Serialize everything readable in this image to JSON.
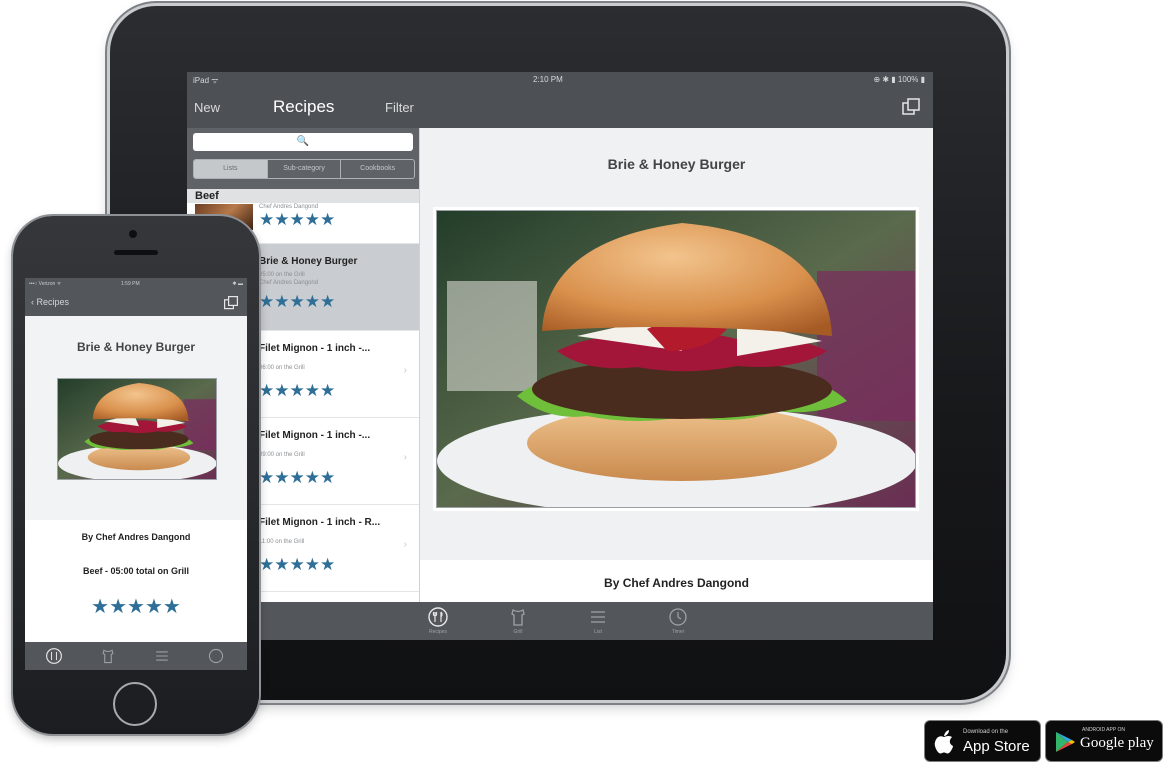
{
  "ipad": {
    "status": {
      "left": "iPad ᯤ",
      "time": "2:10 PM",
      "right": "⊕ ✱ ▮ 100% ▮"
    },
    "nav": {
      "new_label": "New",
      "title": "Recipes",
      "filter_label": "Filter"
    },
    "search": {
      "placeholder": "🔍"
    },
    "segments": [
      "Lists",
      "Sub-category",
      "Cookbooks"
    ],
    "section_header": "Beef",
    "list": [
      {
        "title": "",
        "sub1": "Chef Andres Dangond",
        "sub2": "",
        "stars": "★★★★★",
        "selected": false
      },
      {
        "title": "Brie & Honey Burger",
        "sub1": "05:00 on the Grill",
        "sub2": "Chef Andres Dangond",
        "stars": "★★★★★",
        "selected": true
      },
      {
        "title": "Filet Mignon - 1 inch -...",
        "sub1": "06:00 on the Grill",
        "sub2": "",
        "stars": "★★★★★",
        "selected": false
      },
      {
        "title": "Filet Mignon - 1 inch -...",
        "sub1": "09:00 on the Grill",
        "sub2": "",
        "stars": "★★★★★",
        "selected": false
      },
      {
        "title": "Filet Mignon - 1 inch - R...",
        "sub1": "11:00 on the Grill",
        "sub2": "",
        "stars": "★★★★★",
        "selected": false
      }
    ],
    "detail": {
      "title": "Brie & Honey Burger",
      "byline": "By Chef Andres Dangond"
    },
    "tabbar": [
      {
        "icon": "recipes-icon",
        "label": "Recipes"
      },
      {
        "icon": "apron-icon",
        "label": "Grill"
      },
      {
        "icon": "list-icon",
        "label": "List"
      },
      {
        "icon": "timer-icon",
        "label": "Timer"
      }
    ]
  },
  "iphone": {
    "status": {
      "left": "•••○ Verizon ᯤ",
      "time": "1:59 PM",
      "right": "✱ ▬"
    },
    "nav": {
      "back_label": "Recipes"
    },
    "detail": {
      "title": "Brie & Honey Burger",
      "byline": "By Chef Andres Dangond",
      "meta": "Beef - 05:00 total on Grill",
      "stars": "★★★★★"
    }
  },
  "badges": {
    "apple": {
      "small": "Download on the",
      "big": "App Store"
    },
    "google": {
      "small": "ANDROID APP ON",
      "big": "Google play"
    }
  },
  "colors": {
    "star": "#2f6f97",
    "chrome": "#4d5155",
    "selected_row": "#c9ccd0"
  }
}
